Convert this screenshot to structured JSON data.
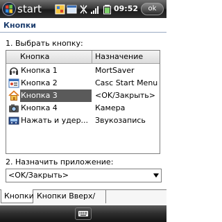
{
  "taskbar": {
    "start_label": "start",
    "clock": "09:52",
    "close_label": "ok",
    "notification_icons": [
      "phone-app-icon",
      "window-icon",
      "connectivity-icon",
      "signal-bars-icon",
      "battery-icon"
    ]
  },
  "page": {
    "title": "Кнопки",
    "select_label": "1. Выбрать кнопку:",
    "assign_label": "2. Назначить приложение:"
  },
  "list": {
    "columns": [
      "Кнопка",
      "Назначение"
    ],
    "rows": [
      {
        "button": "Кнопка 1",
        "action": "MortSaver",
        "icon": "headset-icon",
        "selected": false
      },
      {
        "button": "Кнопка 2",
        "action": "Casc Start Menu",
        "icon": "contact-card-icon",
        "selected": false
      },
      {
        "button": "Кнопка 3",
        "action": "<OK/Закрыть>",
        "icon": "home-icon",
        "selected": true
      },
      {
        "button": "Кнопка 4",
        "action": "Камера",
        "icon": "camera-icon",
        "selected": false
      },
      {
        "button": "Нажать и удер...",
        "action": "Звукозапись",
        "icon": "recorder-icon",
        "selected": false
      }
    ]
  },
  "app_select": {
    "value": "<OK/Закрыть>"
  },
  "tabs": [
    {
      "label": "Кнопки",
      "active": true
    },
    {
      "label": "Кнопки Вверх/Вниз",
      "active": false
    }
  ],
  "bottom": {
    "keyboard_icon": "keyboard-icon"
  }
}
